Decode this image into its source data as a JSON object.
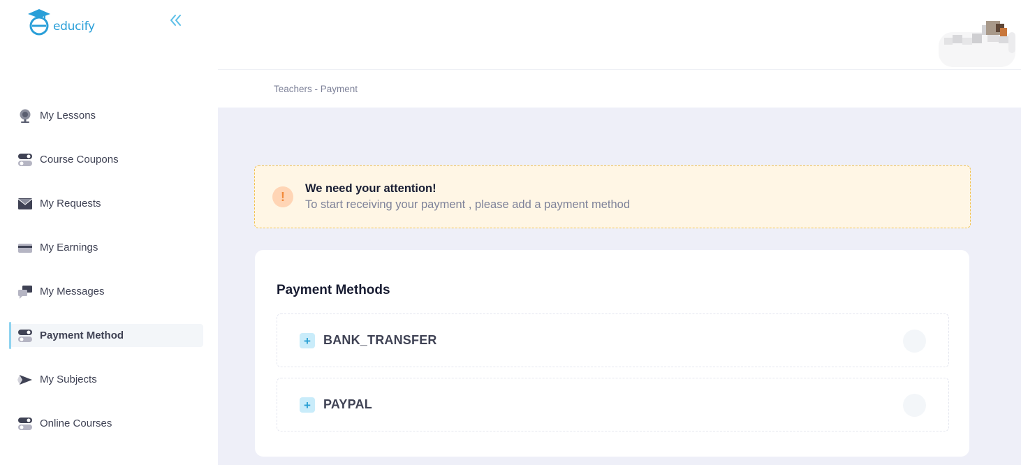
{
  "app": {
    "logo_text": "educify"
  },
  "sidebar": {
    "items": [
      {
        "label": "My Lessons",
        "icon": "webcam-icon"
      },
      {
        "label": "Course Coupons",
        "icon": "toggle-icon"
      },
      {
        "label": "My Requests",
        "icon": "envelope-icon"
      },
      {
        "label": "My Earnings",
        "icon": "credit-card-icon"
      },
      {
        "label": "My Messages",
        "icon": "chat-icon"
      },
      {
        "label": "Payment Method",
        "icon": "toggle-icon",
        "active": true
      },
      {
        "label": "My Subjects",
        "icon": "send-icon"
      },
      {
        "label": "Online Courses",
        "icon": "toggle-icon"
      }
    ]
  },
  "breadcrumb": "Teachers - Payment",
  "alert": {
    "title": "We need your attention!",
    "text": "To start receiving your payment , please add a payment method",
    "icon": "exclamation-icon"
  },
  "payment_methods": {
    "title": "Payment Methods",
    "items": [
      {
        "label": "BANK_TRANSFER"
      },
      {
        "label": "PAYPAL"
      }
    ]
  },
  "colors": {
    "brand": "#2a9fd8",
    "content_bg": "#eeeff8",
    "alert_bg": "#fff6e5",
    "alert_border": "#f2c24f",
    "active_indicator": "#8fd3f0"
  }
}
